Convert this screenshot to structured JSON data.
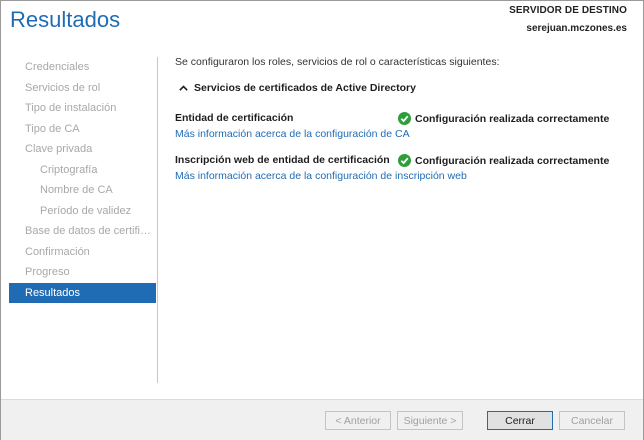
{
  "header": {
    "title": "Resultados",
    "server_label": "SERVIDOR DE DESTINO",
    "server_name": "serejuan.mczones.es"
  },
  "sidebar": {
    "items": [
      {
        "label": "Credenciales"
      },
      {
        "label": "Servicios de rol"
      },
      {
        "label": "Tipo de instalación"
      },
      {
        "label": "Tipo de CA"
      },
      {
        "label": "Clave privada"
      },
      {
        "label": "Criptografía"
      },
      {
        "label": "Nombre de CA"
      },
      {
        "label": "Período de validez"
      },
      {
        "label": "Base de datos de certifica..."
      },
      {
        "label": "Confirmación"
      },
      {
        "label": "Progreso"
      },
      {
        "label": "Resultados"
      }
    ]
  },
  "main": {
    "intro": "Se configuraron los roles, servicios de rol o características siguientes:",
    "group_title": "Servicios de certificados de Active Directory",
    "rows": [
      {
        "title": "Entidad de certificación",
        "status": "Configuración realizada correctamente",
        "link": "Más información acerca de la configuración de CA"
      },
      {
        "title": "Inscripción web de entidad de certificación",
        "status": "Configuración realizada correctamente",
        "link": "Más información acerca de la configuración de inscripción web"
      }
    ]
  },
  "footer": {
    "prev_label": "< Anterior",
    "next_label": "Siguiente >",
    "close_label": "Cerrar",
    "cancel_label": "Cancelar"
  },
  "colors": {
    "accent": "#1f6cb5",
    "success": "#2e9e3a",
    "disabled_text": "#a8a8a8"
  },
  "icons": {
    "group_toggle": "chevron-up-icon",
    "status": "check-circle-icon"
  }
}
